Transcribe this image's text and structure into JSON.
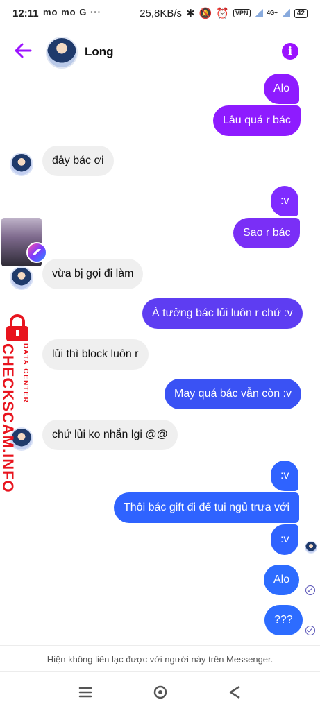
{
  "status_bar": {
    "time": "12:11",
    "app_icons": "mo mo G ···",
    "speed": "25,8KB/s",
    "vpn": "VPN",
    "network": "4G+",
    "battery": "42"
  },
  "header": {
    "contact_name": "Long",
    "info_label": "i"
  },
  "messages": [
    {
      "dir": "out",
      "text": "Alo"
    },
    {
      "dir": "out",
      "text": "Lâu quá r bác"
    },
    {
      "dir": "in",
      "text": "đây bác ơi"
    },
    {
      "dir": "out",
      "text": ":v"
    },
    {
      "dir": "out",
      "text": "Sao r bác"
    },
    {
      "dir": "in",
      "text": "vừa bị gọi đi làm"
    },
    {
      "dir": "out",
      "text": "À tưởng bác lủi luôn r chứ :v"
    },
    {
      "dir": "in",
      "text": "lủi thì block luôn r"
    },
    {
      "dir": "out",
      "text": "May quá bác vẫn còn :v"
    },
    {
      "dir": "in",
      "text": "chứ lủi ko nhắn lgi @@"
    },
    {
      "dir": "out",
      "text": ":v"
    },
    {
      "dir": "out",
      "text": "Thôi bác gift đi để tui ngủ trưa với"
    },
    {
      "dir": "out",
      "text": ":v"
    },
    {
      "dir": "out",
      "text": "Alo"
    },
    {
      "dir": "out",
      "text": "???"
    }
  ],
  "watermark": {
    "site": "CHECKSCAM.INFO",
    "sub": "DATA CENTER"
  },
  "footer": {
    "note": "Hiện không liên lạc được với người này trên Messenger."
  },
  "colors": {
    "accent": "#9b12ff",
    "bubble_purple": "#8e1bff",
    "bubble_blue": "#2f63ff",
    "watermark_red": "#e8141e"
  }
}
